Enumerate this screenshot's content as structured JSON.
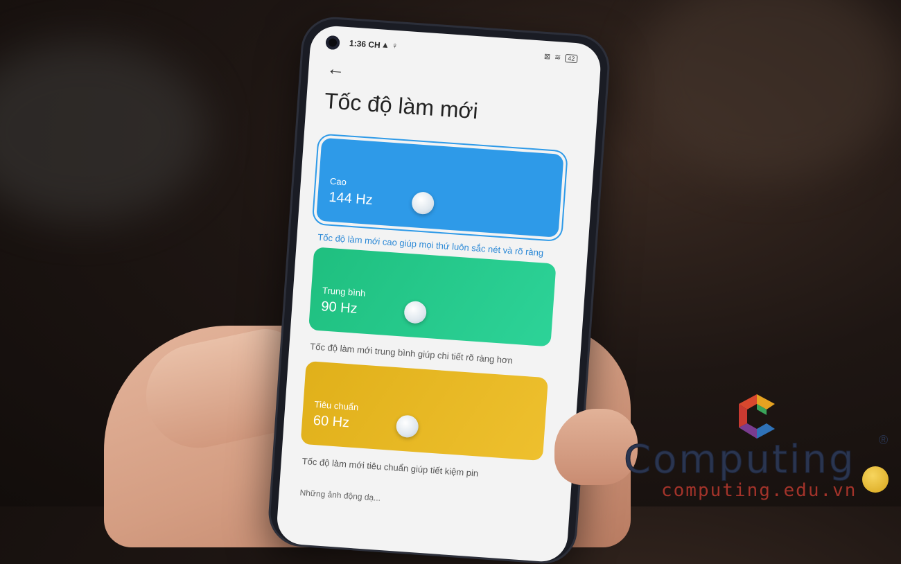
{
  "status_bar": {
    "time": "1:36 CH",
    "icons": "▲ ♀",
    "battery": "42"
  },
  "page": {
    "back_icon": "←",
    "title": "Tốc độ làm mới"
  },
  "options": [
    {
      "label": "Cao",
      "value": "144 Hz",
      "description": "Tốc độ làm mới cao giúp mọi thứ luôn sắc nét và rõ ràng",
      "color": "#2e9ae8",
      "selected": true
    },
    {
      "label": "Trung bình",
      "value": "90 Hz",
      "description": "Tốc độ làm mới trung bình giúp chi tiết rõ ràng hơn",
      "color": "#1fbf7f",
      "selected": false
    },
    {
      "label": "Tiêu chuẩn",
      "value": "60 Hz",
      "description": "Tốc độ làm mới tiêu chuẩn giúp tiết kiệm pin",
      "color": "#e0b01a",
      "selected": false
    }
  ],
  "footer_partial": "Những ảnh động dạ...",
  "watermark": {
    "brand": "Computing",
    "registered": "®",
    "url": "computing.edu.vn"
  }
}
